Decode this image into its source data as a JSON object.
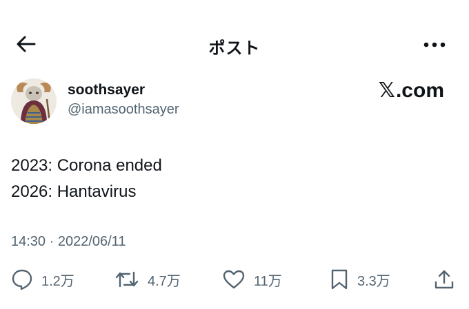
{
  "header": {
    "title": "ポスト",
    "back_icon": "arrow-left-icon",
    "more_icon": "more-horizontal-icon"
  },
  "author": {
    "display_name": "soothsayer",
    "handle": "@iamasoothsayer"
  },
  "brand": {
    "x_glyph": "𝕏",
    "suffix": ".com"
  },
  "tweet": {
    "lines": [
      "2023: Corona ended",
      "2026: Hantavirus"
    ]
  },
  "timestamp": "14:30 · 2022/06/11",
  "actions": {
    "replies": "1.2万",
    "reposts": "4.7万",
    "likes": "11万",
    "bookmarks": "3.3万"
  },
  "colors": {
    "text": "#0f1419",
    "secondary": "#536471"
  }
}
